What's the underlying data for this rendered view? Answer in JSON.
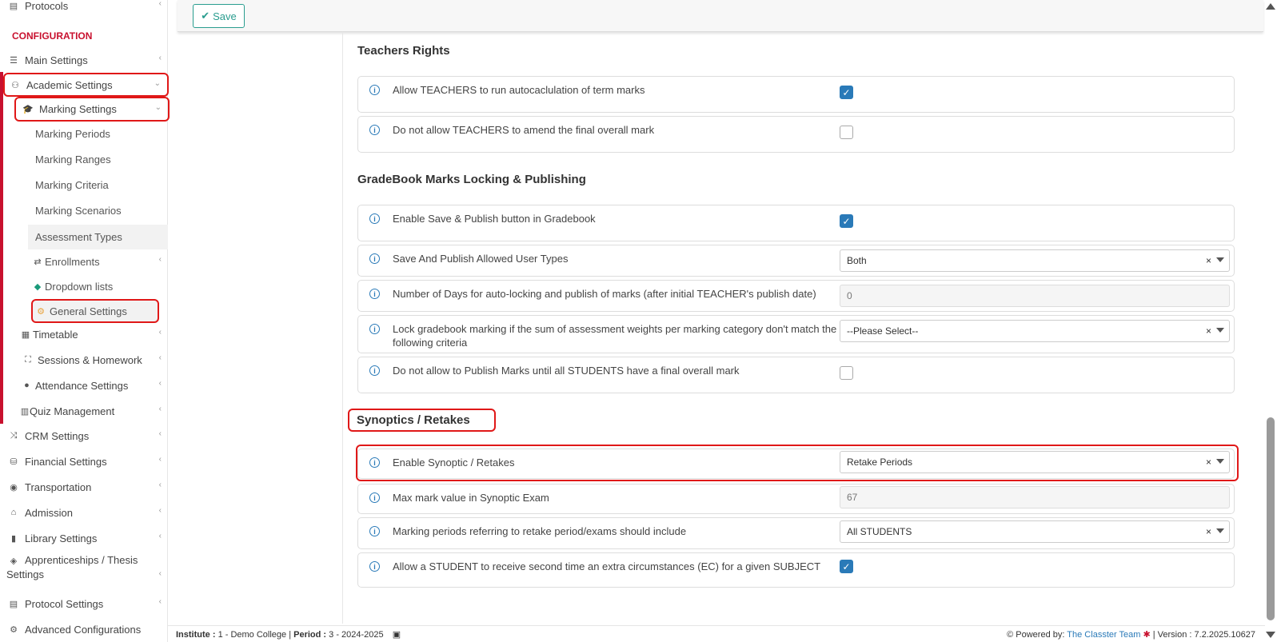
{
  "sidebar": {
    "protocols": "Protocols",
    "configuration_heading": "CONFIGURATION",
    "main_settings": "Main Settings",
    "academic_settings": "Academic Settings",
    "marking_settings": "Marking Settings",
    "marking_periods": "Marking Periods",
    "marking_ranges": "Marking Ranges",
    "marking_criteria": "Marking Criteria",
    "marking_scenarios": "Marking Scenarios",
    "assessment_types": "Assessment Types",
    "enrollments": "Enrollments",
    "dropdown_lists": "Dropdown lists",
    "general_settings": "General Settings",
    "timetable": "Timetable",
    "sessions_homework": "Sessions & Homework",
    "attendance_settings": "Attendance Settings",
    "quiz_management": "Quiz Management",
    "crm_settings": "CRM Settings",
    "financial_settings": "Financial Settings",
    "transportation": "Transportation",
    "admission": "Admission",
    "library_settings": "Library Settings",
    "apprenticeships_line1": "Apprenticeships / Thesis",
    "apprenticeships_line2": "Settings",
    "protocol_settings": "Protocol Settings",
    "advanced_configurations": "Advanced Configurations"
  },
  "toolbar": {
    "save_label": "Save"
  },
  "sections": {
    "teachers_rights": "Teachers Rights",
    "gradebook": "GradeBook Marks Locking & Publishing",
    "synoptics": "Synoptics / Retakes"
  },
  "rows": {
    "allow_autocalc": "Allow TEACHERS to run autocaclulation of term marks",
    "no_amend": "Do not allow TEACHERS to amend the final overall mark",
    "enable_publish": "Enable Save & Publish button in Gradebook",
    "publish_user_types": "Save And Publish Allowed User Types",
    "publish_user_types_value": "Both",
    "autolock_days": "Number of Days for auto-locking and publish of marks (after initial TEACHER's publish date)",
    "autolock_days_value": "0",
    "lock_weights": "Lock gradebook marking if the sum of assessment weights per marking category don't match the following criteria",
    "lock_weights_value": "--Please Select--",
    "no_publish_until": "Do not allow to Publish Marks until all STUDENTS have a final overall mark",
    "enable_synoptic": "Enable Synoptic / Retakes",
    "enable_synoptic_value": "Retake Periods",
    "max_mark": "Max mark value in Synoptic Exam",
    "max_mark_value": "67",
    "marking_periods_include": "Marking periods referring to retake period/exams should include",
    "marking_periods_include_value": "All STUDENTS",
    "second_ec": "Allow a STUDENT to receive second time an extra circumstances (EC) for a given SUBJECT"
  },
  "checkboxes": {
    "allow_autocalc": true,
    "no_amend": false,
    "enable_publish": true,
    "no_publish_until": false,
    "second_ec": true
  },
  "footer": {
    "institute_label": "Institute :",
    "institute_value": "1 - Demo College",
    "period_label": "Period :",
    "period_value": "3 - 2024-2025",
    "powered_by": "Powered by:",
    "team": "The Classter Team",
    "version": "| Version : 7.2.2025.10627"
  },
  "colors": {
    "accent_red": "#c8102e",
    "checkbox_blue": "#2a7ab8",
    "save_green": "#2a9d8f"
  }
}
